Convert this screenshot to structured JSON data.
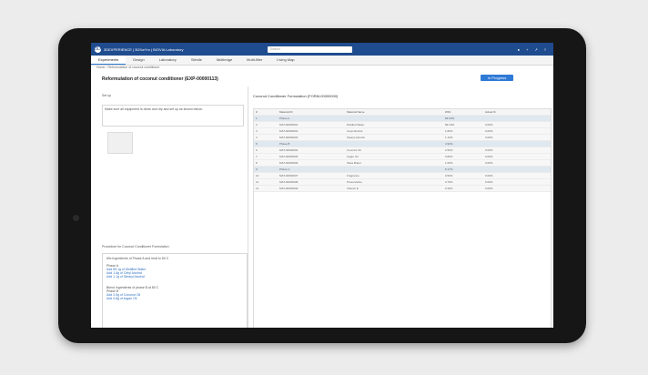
{
  "topbar": {
    "brand": "3DEXPERIENCE | 3DSwYm | BIOVIA Laboratory",
    "search": "Search"
  },
  "tabs": [
    {
      "label": "Experiments",
      "active": true
    },
    {
      "label": "Design"
    },
    {
      "label": "Laboratory"
    },
    {
      "label": "Stimile"
    },
    {
      "label": "Multiedge"
    },
    {
      "label": "Multi-filler"
    },
    {
      "label": "Living Map"
    }
  ],
  "crumb": "Home › Reformulation of coconut conditioner",
  "title": "Reformulation of coconut conditioner (EXP-00000113)",
  "status": "In Progress",
  "left": {
    "section1": "Set up",
    "note1": "Make sure all equipment is clean and dry and set up as shown below.",
    "section2": "Procedure for Coconut Conditioner Formulation",
    "procedure": [
      "Mix Ingredients of Phase A and heat to 80 C",
      "Phase A",
      "Add 89.1g of Distilled Water",
      "Add 1.8g of Cetyl Alcohol",
      "Add 1.1g of Stearyl Alcohol",
      "Blend Ingredients of phase B at 80 C",
      "Phase B",
      "Add 2.5g of Coconut Oil",
      "Add 0.8g of Argan Oil"
    ]
  },
  "right": {
    "panel_title": "Coconut Conditioner Formulation (FORM-00000000)",
    "columns": [
      "#",
      "",
      "Material ID",
      "Material Name",
      "Wt%",
      "Actual %",
      ""
    ],
    "rows": [
      {
        "type": "phase",
        "label": "Phase A",
        "val": "89.93%"
      },
      {
        "type": "item",
        "id": "MAT-00000001",
        "name": "Distilled Water",
        "wt": "89.10%",
        "act": "0.00%"
      },
      {
        "type": "item",
        "id": "MAT-00000002",
        "name": "Cetyl Alcohol",
        "wt": "1.80%",
        "act": "0.00%"
      },
      {
        "type": "item",
        "id": "MAT-00000003",
        "name": "Stearyl Alcohol",
        "wt": "1.10%",
        "act": "0.00%"
      },
      {
        "type": "phase",
        "label": "Phase B",
        "val": "4.90%"
      },
      {
        "type": "item",
        "id": "MAT-00000004",
        "name": "Coconut Oil",
        "wt": "2.50%",
        "act": "0.00%"
      },
      {
        "type": "item",
        "id": "MAT-00000005",
        "name": "Argan Oil",
        "wt": "0.80%",
        "act": "0.00%"
      },
      {
        "type": "item",
        "id": "MAT-00000006",
        "name": "Shea Butter",
        "wt": "1.60%",
        "act": "0.00%"
      },
      {
        "type": "phase",
        "label": "Phase C",
        "val": "5.17%"
      },
      {
        "type": "item",
        "id": "MAT-00000007",
        "name": "Fragrance",
        "wt": "0.50%",
        "act": "0.00%"
      },
      {
        "type": "item",
        "id": "MAT-00000008",
        "name": "Preservative",
        "wt": "0.70%",
        "act": "0.00%"
      },
      {
        "type": "item",
        "id": "MAT-00000009",
        "name": "Vitamin E",
        "wt": "0.30%",
        "act": "0.00%"
      }
    ]
  }
}
